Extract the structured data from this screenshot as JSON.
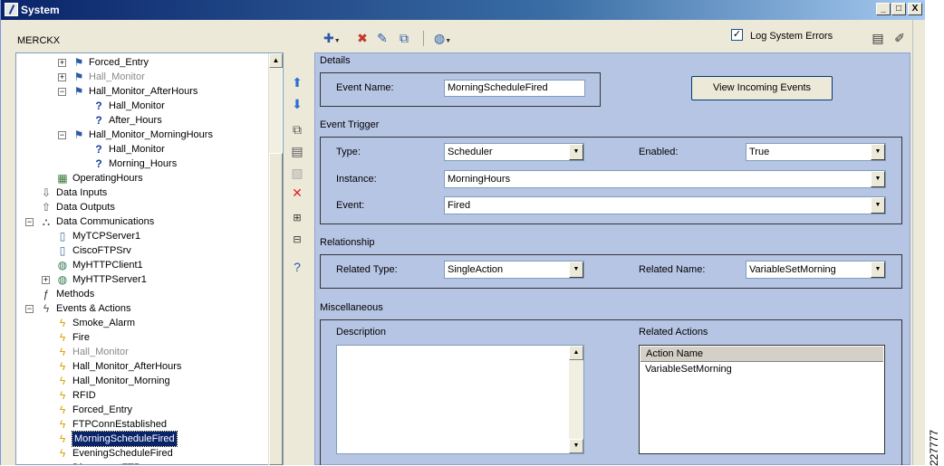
{
  "window": {
    "title": "System",
    "min": "_",
    "max": "□",
    "close": "X"
  },
  "tree": {
    "title": "MERCKX",
    "rows": [
      {
        "label": "Forced_Entry",
        "exp": "+",
        "icon": "flag",
        "indent": 0
      },
      {
        "label": "Hall_Monitor",
        "exp": "+",
        "icon": "flag",
        "indent": 0,
        "grey": true
      },
      {
        "label": "Hall_Monitor_AfterHours",
        "exp": "-",
        "icon": "flag",
        "indent": 0
      },
      {
        "label": "Hall_Monitor",
        "exp": "",
        "icon": "question",
        "indent": 1
      },
      {
        "label": "After_Hours",
        "exp": "",
        "icon": "question",
        "indent": 1
      },
      {
        "label": "Hall_Monitor_MorningHours",
        "exp": "-",
        "icon": "flag",
        "indent": 0
      },
      {
        "label": "Hall_Monitor",
        "exp": "",
        "icon": "question",
        "indent": 1
      },
      {
        "label": "Morning_Hours",
        "exp": "",
        "icon": "question",
        "indent": 1
      },
      {
        "label": "OperatingHours",
        "exp": "",
        "icon": "calendar",
        "indent": -1
      },
      {
        "label": "Data Inputs",
        "exp": "",
        "icon": "data-in",
        "indent": -2
      },
      {
        "label": "Data Outputs",
        "exp": "",
        "icon": "data-out",
        "indent": -2
      },
      {
        "label": "Data Communications",
        "exp": "-",
        "icon": "network",
        "indent": -2
      },
      {
        "label": "MyTCPServer1",
        "exp": "",
        "icon": "server",
        "indent": -1
      },
      {
        "label": "CiscoFTPSrv",
        "exp": "",
        "icon": "server",
        "indent": -1
      },
      {
        "label": "MyHTTPClient1",
        "exp": "",
        "icon": "globe",
        "indent": -1
      },
      {
        "label": "MyHTTPServer1",
        "exp": "+",
        "icon": "globe",
        "indent": -1
      },
      {
        "label": "Methods",
        "exp": "",
        "icon": "fx",
        "indent": -2
      },
      {
        "label": "Events & Actions",
        "exp": "-",
        "icon": "events",
        "indent": -2
      },
      {
        "label": "Smoke_Alarm",
        "exp": "",
        "icon": "bolt",
        "indent": -1
      },
      {
        "label": "Fire",
        "exp": "",
        "icon": "bolt",
        "indent": -1
      },
      {
        "label": "Hall_Monitor",
        "exp": "",
        "icon": "bolt",
        "indent": -1,
        "grey": true
      },
      {
        "label": "Hall_Monitor_AfterHours",
        "exp": "",
        "icon": "bolt",
        "indent": -1
      },
      {
        "label": "Hall_Monitor_Morning",
        "exp": "",
        "icon": "bolt",
        "indent": -1
      },
      {
        "label": "RFID",
        "exp": "",
        "icon": "bolt",
        "indent": -1
      },
      {
        "label": "Forced_Entry",
        "exp": "",
        "icon": "bolt",
        "indent": -1
      },
      {
        "label": "FTPConnEstablished",
        "exp": "",
        "icon": "bolt",
        "indent": -1
      },
      {
        "label": "MorningScheduleFired",
        "exp": "",
        "icon": "bolt",
        "indent": -1,
        "selected": true
      },
      {
        "label": "EveningScheduleFired",
        "exp": "",
        "icon": "bolt",
        "indent": -1
      },
      {
        "label": "DisconnectFTP",
        "exp": "",
        "icon": "grid",
        "indent": -1
      }
    ]
  },
  "header": {
    "log_errors_label": "Log System Errors",
    "log_errors_checked": "✓"
  },
  "details": {
    "section_label": "Details",
    "event_name_label": "Event Name:",
    "event_name_value": "MorningScheduleFired",
    "view_button": "View Incoming Events"
  },
  "trigger": {
    "section_label": "Event Trigger",
    "type_label": "Type:",
    "type_value": "Scheduler",
    "enabled_label": "Enabled:",
    "enabled_value": "True",
    "instance_label": "Instance:",
    "instance_value": "MorningHours",
    "event_label": "Event:",
    "event_value": "Fired"
  },
  "relationship": {
    "section_label": "Relationship",
    "related_type_label": "Related Type:",
    "related_type_value": "SingleAction",
    "related_name_label": "Related Name:",
    "related_name_value": "VariableSetMorning"
  },
  "misc": {
    "section_label": "Miscellaneous",
    "description_label": "Description",
    "related_actions_label": "Related Actions",
    "actions_column": "Action Name",
    "actions": [
      "VariableSetMorning"
    ]
  },
  "figure_number": "227777"
}
